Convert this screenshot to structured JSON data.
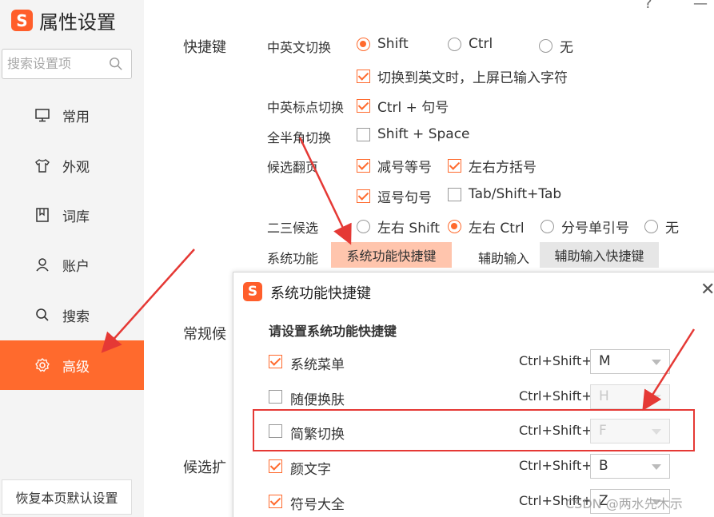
{
  "app": {
    "logo_char": "S",
    "title": "属性设置"
  },
  "search": {
    "placeholder": "搜索设置项"
  },
  "sidebar": {
    "items": [
      {
        "label": "常用",
        "icon": "monitor-icon"
      },
      {
        "label": "外观",
        "icon": "shirt-icon"
      },
      {
        "label": "词库",
        "icon": "book-icon"
      },
      {
        "label": "账户",
        "icon": "user-icon"
      },
      {
        "label": "搜索",
        "icon": "search-icon"
      },
      {
        "label": "高级",
        "icon": "gear-icon",
        "active": true
      }
    ],
    "restore_label": "恢复本页默认设置"
  },
  "window": {
    "help": "?",
    "minimize": "—"
  },
  "sections": {
    "shortcuts": "快捷键",
    "general": "常规候",
    "candidate_ext": "候选扩"
  },
  "rows": {
    "cn_en_switch": {
      "label": "中英文切换",
      "options": [
        "Shift",
        "Ctrl",
        "无"
      ],
      "selected": "Shift",
      "sub_checkbox": "切换到英文时，上屏已输入字符",
      "sub_checked": true
    },
    "punct_switch": {
      "label": "中英标点切换",
      "option": "Ctrl + 句号",
      "checked": true
    },
    "fullhalf_switch": {
      "label": "全半角切换",
      "option": "Shift + Space",
      "checked": false
    },
    "candidate_page": {
      "label": "候选翻页",
      "options": [
        {
          "text": "减号等号",
          "checked": true
        },
        {
          "text": "左右方括号",
          "checked": true
        },
        {
          "text": "逗号句号",
          "checked": true
        },
        {
          "text": "Tab/Shift+Tab",
          "checked": false
        }
      ]
    },
    "second_third": {
      "label": "二三候选",
      "options": [
        "左右 Shift",
        "左右 Ctrl",
        "分号单引号",
        "无"
      ],
      "selected": "左右 Ctrl"
    },
    "system_func": {
      "label": "系统功能",
      "button": "系统功能快捷键",
      "aux_label": "辅助输入",
      "aux_button": "辅助输入快捷键"
    }
  },
  "dialog": {
    "logo_char": "S",
    "title": "系统功能快捷键",
    "close": "✕",
    "subtitle": "请设置系统功能快捷键",
    "modifier": "Ctrl+Shift+",
    "items": [
      {
        "name": "系统菜单",
        "checked": true,
        "key": "M",
        "enabled": true
      },
      {
        "name": "随便换肤",
        "checked": false,
        "key": "H",
        "enabled": false
      },
      {
        "name": "简繁切换",
        "checked": false,
        "key": "F",
        "enabled": false
      },
      {
        "name": "颜文字",
        "checked": true,
        "key": "B",
        "enabled": true
      },
      {
        "name": "符号大全",
        "checked": true,
        "key": "Z",
        "enabled": true
      }
    ]
  },
  "watermark": "CSDN @两水先木示",
  "colors": {
    "accent": "#ff6a2d",
    "annotation": "#e53935",
    "button_highlight": "#ffc5ad"
  }
}
